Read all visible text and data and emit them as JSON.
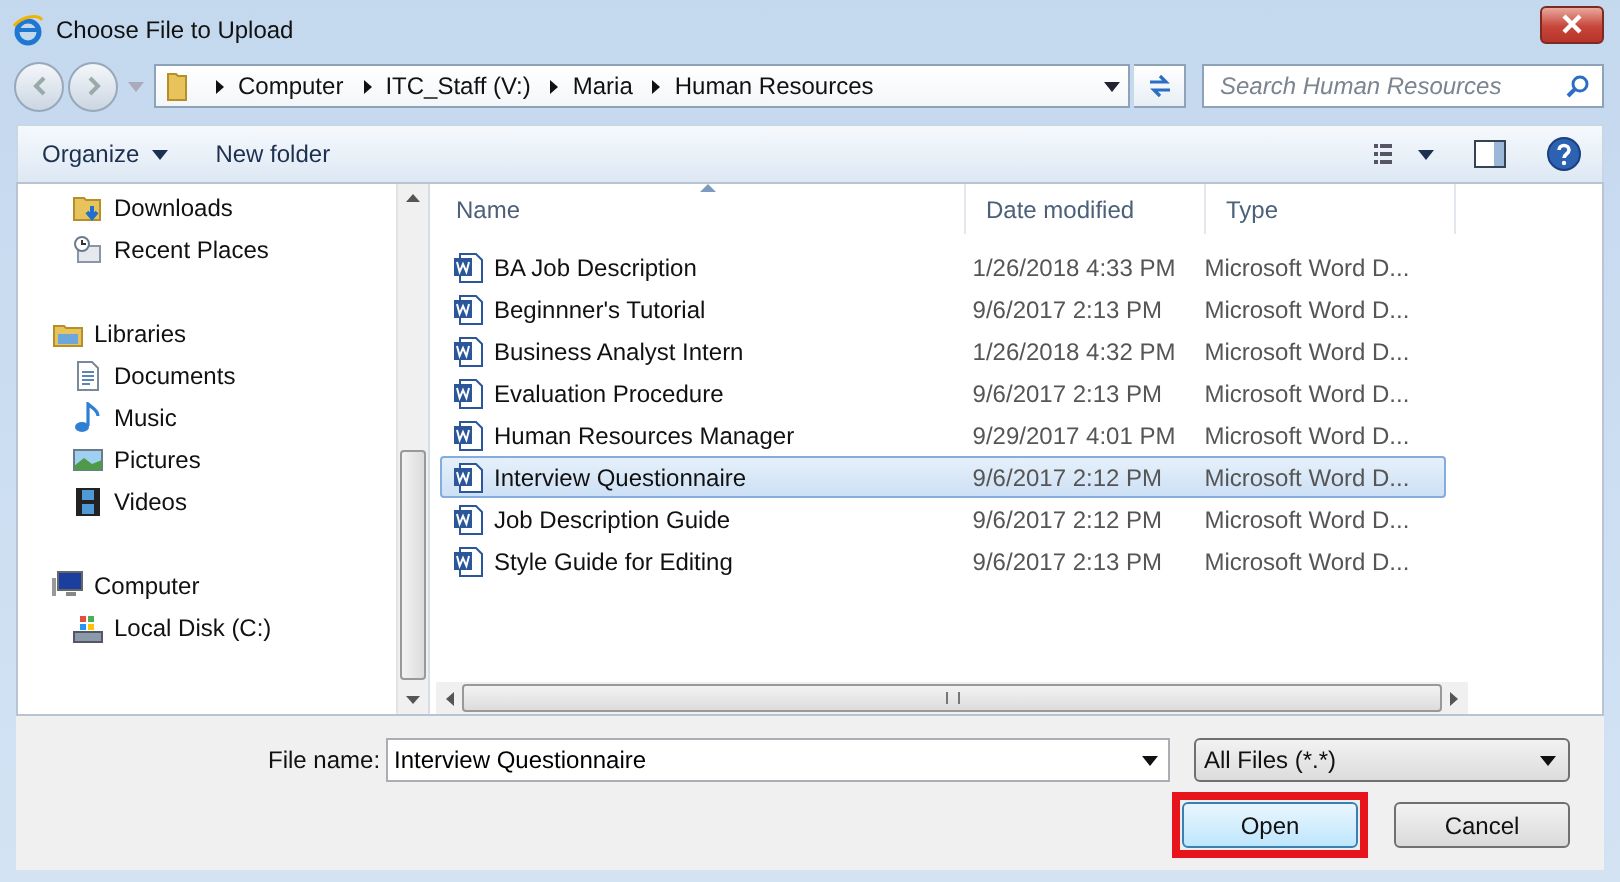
{
  "window": {
    "title": "Choose File to Upload"
  },
  "address": {
    "crumbs": [
      "Computer",
      "ITC_Staff (V:)",
      "Maria",
      "Human Resources"
    ]
  },
  "search": {
    "placeholder": "Search Human Resources"
  },
  "toolbar": {
    "organize": "Organize",
    "new_folder": "New folder"
  },
  "sidebar": {
    "items": [
      {
        "label": "Downloads",
        "kind": "downloads"
      },
      {
        "label": "Recent Places",
        "kind": "recent"
      }
    ],
    "groups": [
      {
        "label": "Libraries",
        "kind": "library",
        "children": [
          {
            "label": "Documents",
            "kind": "documents"
          },
          {
            "label": "Music",
            "kind": "music"
          },
          {
            "label": "Pictures",
            "kind": "pictures"
          },
          {
            "label": "Videos",
            "kind": "videos"
          }
        ]
      },
      {
        "label": "Computer",
        "kind": "computer",
        "children": [
          {
            "label": "Local Disk (C:)",
            "kind": "disk"
          }
        ]
      }
    ]
  },
  "table": {
    "columns": [
      {
        "label": "Name",
        "sorted": true
      },
      {
        "label": "Date modified",
        "sorted": false
      },
      {
        "label": "Type",
        "sorted": false
      }
    ],
    "rows": [
      {
        "name": "BA Job Description",
        "date": "1/26/2018 4:33 PM",
        "type": "Microsoft Word D...",
        "selected": false
      },
      {
        "name": "Beginnner's Tutorial",
        "date": "9/6/2017 2:13 PM",
        "type": "Microsoft Word D...",
        "selected": false
      },
      {
        "name": "Business Analyst Intern",
        "date": "1/26/2018 4:32 PM",
        "type": "Microsoft Word D...",
        "selected": false
      },
      {
        "name": "Evaluation Procedure",
        "date": "9/6/2017 2:13 PM",
        "type": "Microsoft Word D...",
        "selected": false
      },
      {
        "name": "Human Resources Manager",
        "date": "9/29/2017 4:01 PM",
        "type": "Microsoft Word D...",
        "selected": false
      },
      {
        "name": "Interview Questionnaire",
        "date": "9/6/2017 2:12 PM",
        "type": "Microsoft Word D...",
        "selected": true
      },
      {
        "name": "Job Description Guide",
        "date": "9/6/2017 2:12 PM",
        "type": "Microsoft Word D...",
        "selected": false
      },
      {
        "name": "Style Guide for Editing",
        "date": "9/6/2017 2:13 PM",
        "type": "Microsoft Word D...",
        "selected": false
      }
    ]
  },
  "file_name": {
    "label": "File name:",
    "value": "Interview Questionnaire"
  },
  "filter": {
    "value": "All Files (*.*)"
  },
  "buttons": [
    {
      "label": "Open",
      "kind": "primary",
      "highlighted": true
    },
    {
      "label": "Cancel",
      "kind": "normal",
      "highlighted": false
    }
  ]
}
